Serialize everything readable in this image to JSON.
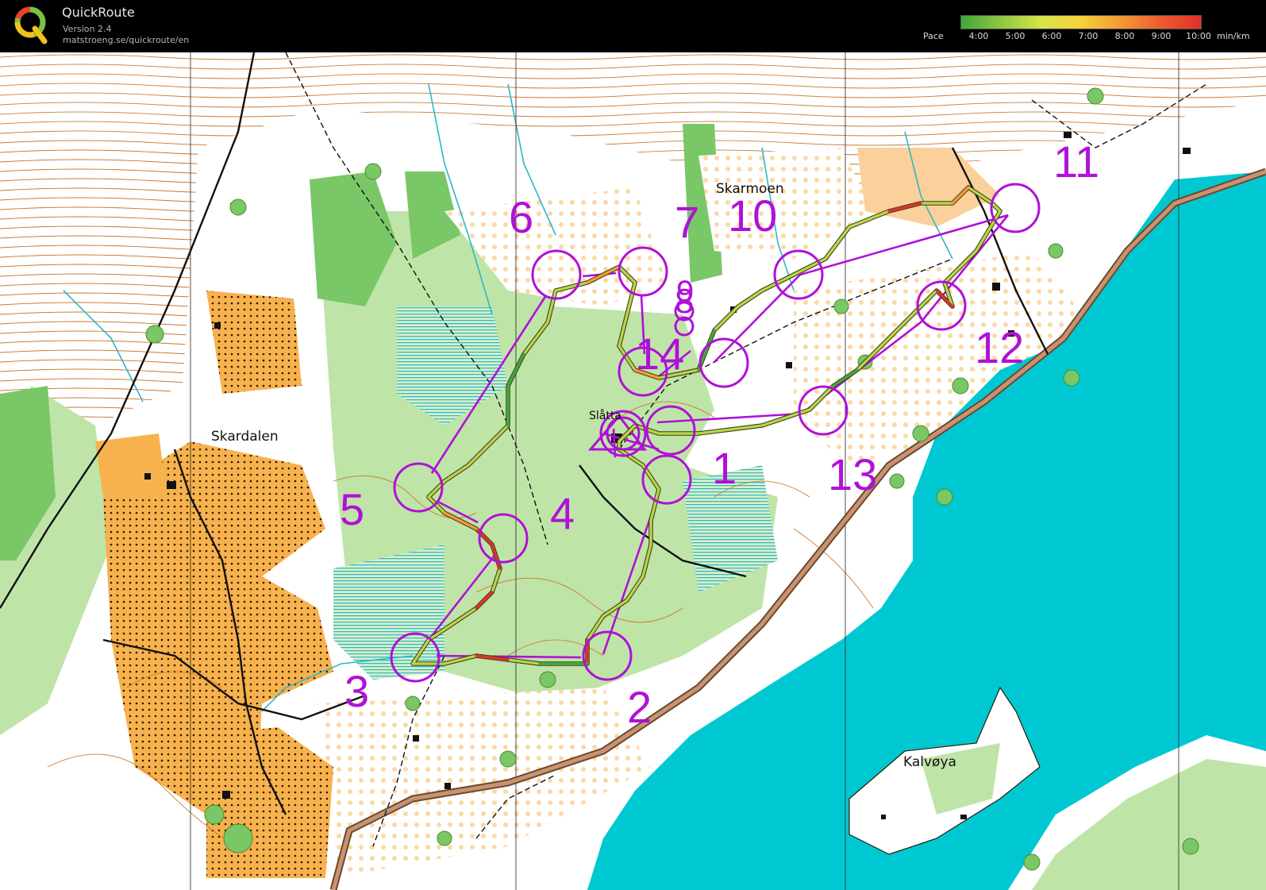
{
  "header": {
    "app_name": "QuickRoute",
    "version": "Version 2.4",
    "url": "matstroeng.se/quickroute/en",
    "pace_label": "Pace",
    "pace_ticks": [
      "4:00",
      "5:00",
      "6:00",
      "7:00",
      "8:00",
      "9:00",
      "10:00"
    ],
    "pace_unit": "min/km",
    "pace_colors": [
      "#3fa83a",
      "#8fc640",
      "#d7e44a",
      "#f5d23a",
      "#f39a33",
      "#ee5b2f",
      "#e0302a"
    ]
  },
  "map": {
    "place_names": [
      "Skarmoen",
      "Skardalen",
      "Slåtta",
      "Kalvøya"
    ],
    "controls": [
      "1",
      "2",
      "3",
      "4",
      "5",
      "6",
      "7",
      "8",
      "9",
      "10",
      "11",
      "12",
      "13",
      "14"
    ],
    "colors": {
      "course": "#b010d8",
      "water": "#00c8d2",
      "field": "#f7b14d",
      "forest_light": "#bfe4a8",
      "forest_dark": "#79c767",
      "contour": "#c9762e",
      "stream": "#2bb7c9",
      "road": "#b57c5a"
    }
  }
}
